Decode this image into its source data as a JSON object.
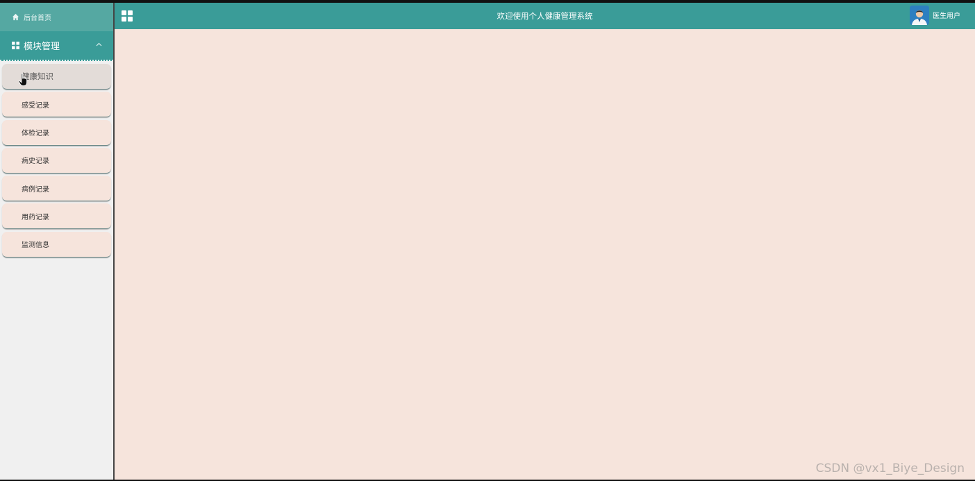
{
  "sidebar": {
    "home": {
      "icon": "home-icon",
      "label": "后台首页"
    },
    "module": {
      "icon": "grid-icon",
      "label": "模块管理",
      "chevron": "chevron-up-icon"
    },
    "items": [
      {
        "label": "健康知识",
        "active": true
      },
      {
        "label": "感受记录"
      },
      {
        "label": "体检记录"
      },
      {
        "label": "病史记录"
      },
      {
        "label": "病例记录"
      },
      {
        "label": "用药记录"
      },
      {
        "label": "监测信息"
      }
    ]
  },
  "header": {
    "menu_icon": "grid-menu-icon",
    "title": "欢迎使用个人健康管理系统",
    "user": {
      "avatar": "avatar",
      "name": "医生用户"
    }
  },
  "watermark": "CSDN @vx1_Biye_Design",
  "colors": {
    "accent": "#3a9c98",
    "home_bg": "#55a8a2",
    "content_bg": "#f6e4dc",
    "sidebar_bg": "#f0f0f0"
  }
}
